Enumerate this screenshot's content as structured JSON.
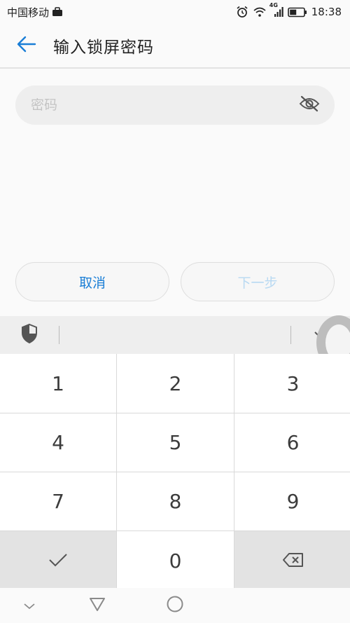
{
  "status_bar": {
    "carrier": "中国移动",
    "network": "4G",
    "time": "18:38"
  },
  "header": {
    "title": "输入锁屏密码"
  },
  "password": {
    "placeholder": "密码",
    "value": ""
  },
  "buttons": {
    "cancel": "取消",
    "next": "下一步"
  },
  "keypad": {
    "keys": [
      "1",
      "2",
      "3",
      "4",
      "5",
      "6",
      "7",
      "8",
      "9",
      "0"
    ]
  },
  "colors": {
    "accent": "#1a7ed6",
    "disabled_text": "#b8d9f2",
    "background": "#fafafa"
  },
  "icons": [
    "briefcase-icon",
    "alarm-icon",
    "wifi-icon",
    "signal-icon",
    "battery-icon",
    "back-arrow-icon",
    "eye-off-icon",
    "shield-icon",
    "chevron-down-icon",
    "check-icon",
    "backspace-icon",
    "nav-back-icon",
    "nav-home-icon"
  ]
}
